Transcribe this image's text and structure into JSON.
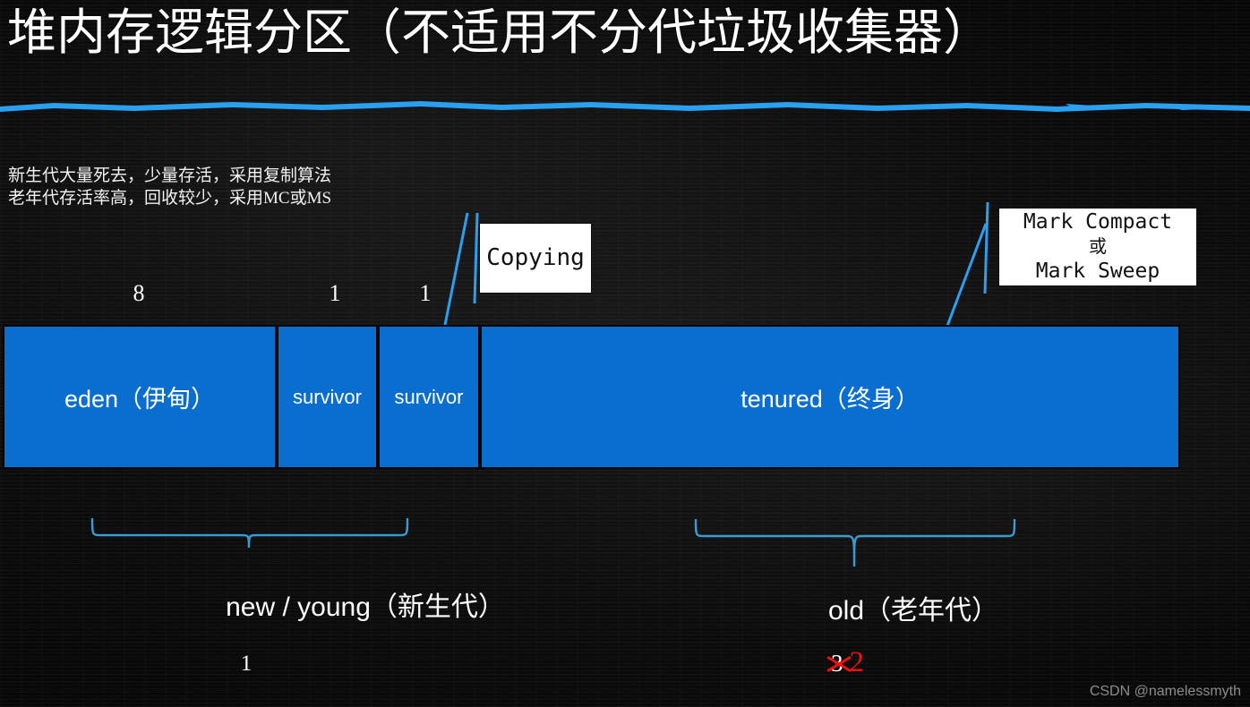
{
  "slide": {
    "title": "堆内存逻辑分区（不适用不分代垃圾收集器）",
    "accent_blue": "#29a0f0",
    "region_blue": "#0a6ed1",
    "red": "#f31010",
    "background": "#0c0c0c"
  },
  "notes": {
    "line1": "新生代大量死去，少量存活，采用复制算法",
    "line2": "老年代存活率高，回收较少，采用MC或MS"
  },
  "ratios": {
    "eden": "8",
    "survivor0": "1",
    "survivor1": "1"
  },
  "callouts": {
    "copying": {
      "text": "Copying"
    },
    "mark": {
      "line1": "Mark Compact",
      "line2": "或",
      "line3": "Mark Sweep"
    }
  },
  "heap": {
    "regions": [
      {
        "label": "eden（伊甸）",
        "name": "eden"
      },
      {
        "label": "survivor",
        "name": "survivor0"
      },
      {
        "label": "survivor",
        "name": "survivor1"
      },
      {
        "label": "tenured（终身）",
        "name": "tenured"
      }
    ]
  },
  "groups": {
    "young_label": "new / young（新生代）",
    "young_count": "1",
    "old_label": "old（老年代）",
    "old_count_struck": "3",
    "old_count_new": "2"
  },
  "watermark": "CSDN @namelessmyth"
}
